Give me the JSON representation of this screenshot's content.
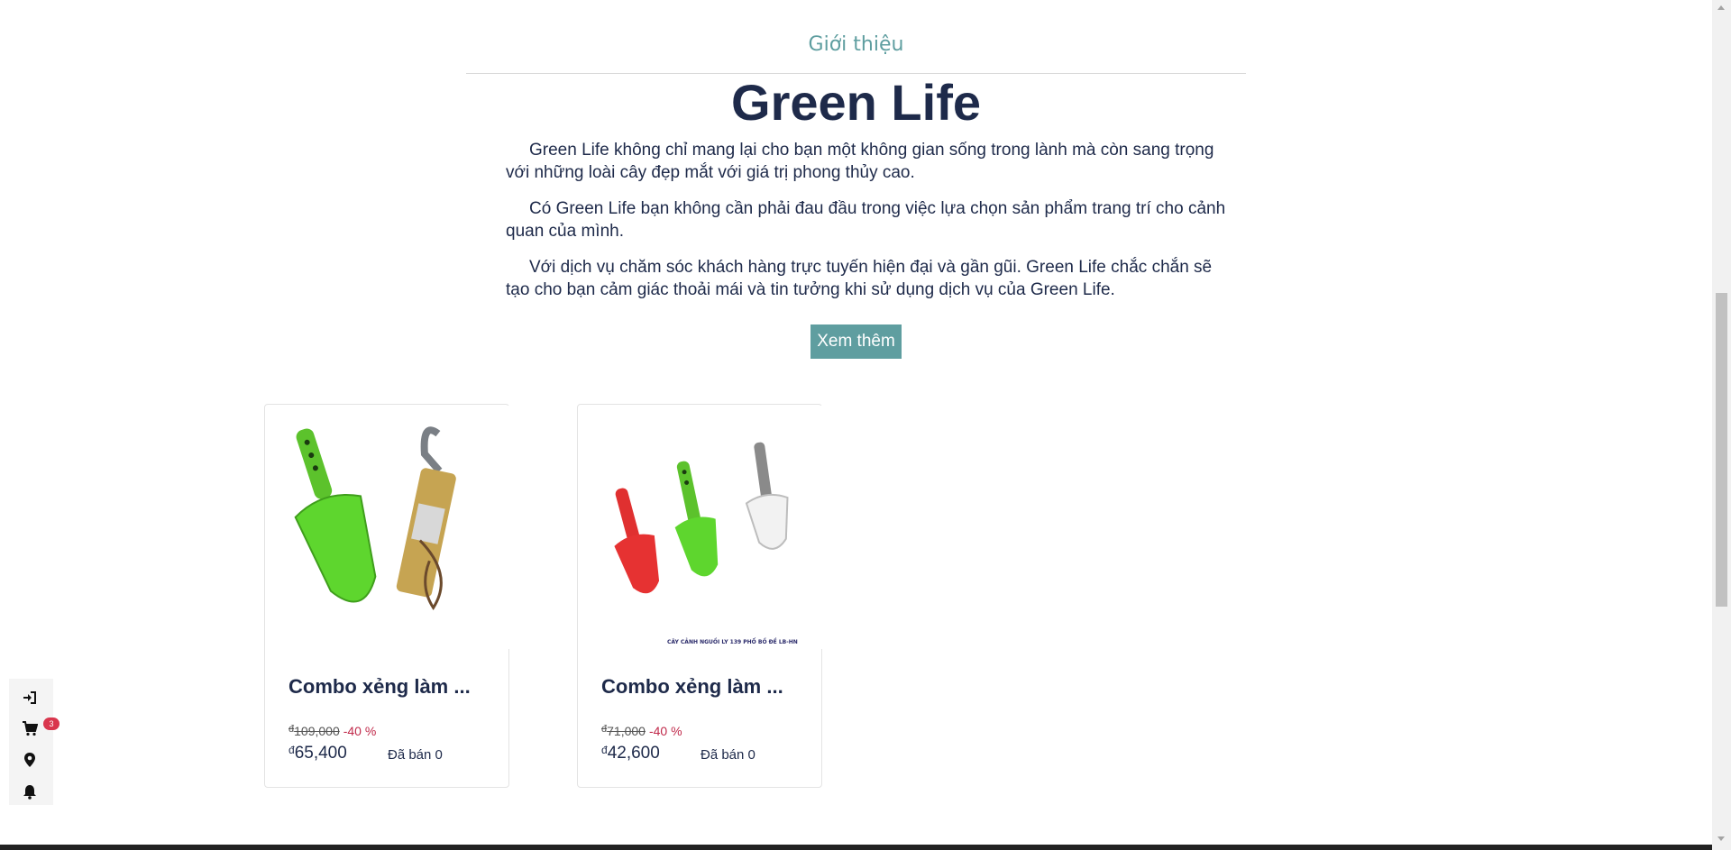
{
  "intro": {
    "label": "Giới thiệu",
    "title": "Green Life",
    "paragraphs": [
      "Green Life không chỉ mang lại cho bạn một không gian sống trong lành mà còn sang trọng với những loài cây đẹp mắt với giá trị phong thủy cao.",
      "Có Green Life bạn không cần phải đau đầu trong việc lựa chọn sản phẩm trang trí cho cảnh quan của mình.",
      "Với dịch vụ chăm sóc khách hàng trực tuyến hiện đại và gần gũi. Green Life chắc chắn sẽ tạo cho bạn cảm giác thoải mái và tin tưởng khi sử dụng dịch vụ của Green Life."
    ],
    "more_button": "Xem thêm"
  },
  "products": [
    {
      "title": "Combo xẻng làm ...",
      "currency": "đ",
      "old_price": "109,000",
      "discount": "-40 %",
      "price": "65,400",
      "sold": "Đã bán 0"
    },
    {
      "title": "Combo xẻng làm ...",
      "currency": "đ",
      "old_price": "71,000",
      "discount": "-40 %",
      "price": "42,600",
      "sold": "Đã bán 0",
      "image_caption": "CÂY CẢNH NGUỒI LY 139 PHỐ BỒ ĐỀ LB-HN"
    }
  ],
  "side_bar": {
    "icons": [
      "sign-in-icon",
      "cart-icon",
      "map-marker-icon",
      "bell-icon"
    ],
    "cart_count": "3"
  },
  "colors": {
    "accent": "#5f9ea0",
    "title": "#1e2a4a",
    "discount": "#c0294a",
    "badge": "#d9364d"
  }
}
